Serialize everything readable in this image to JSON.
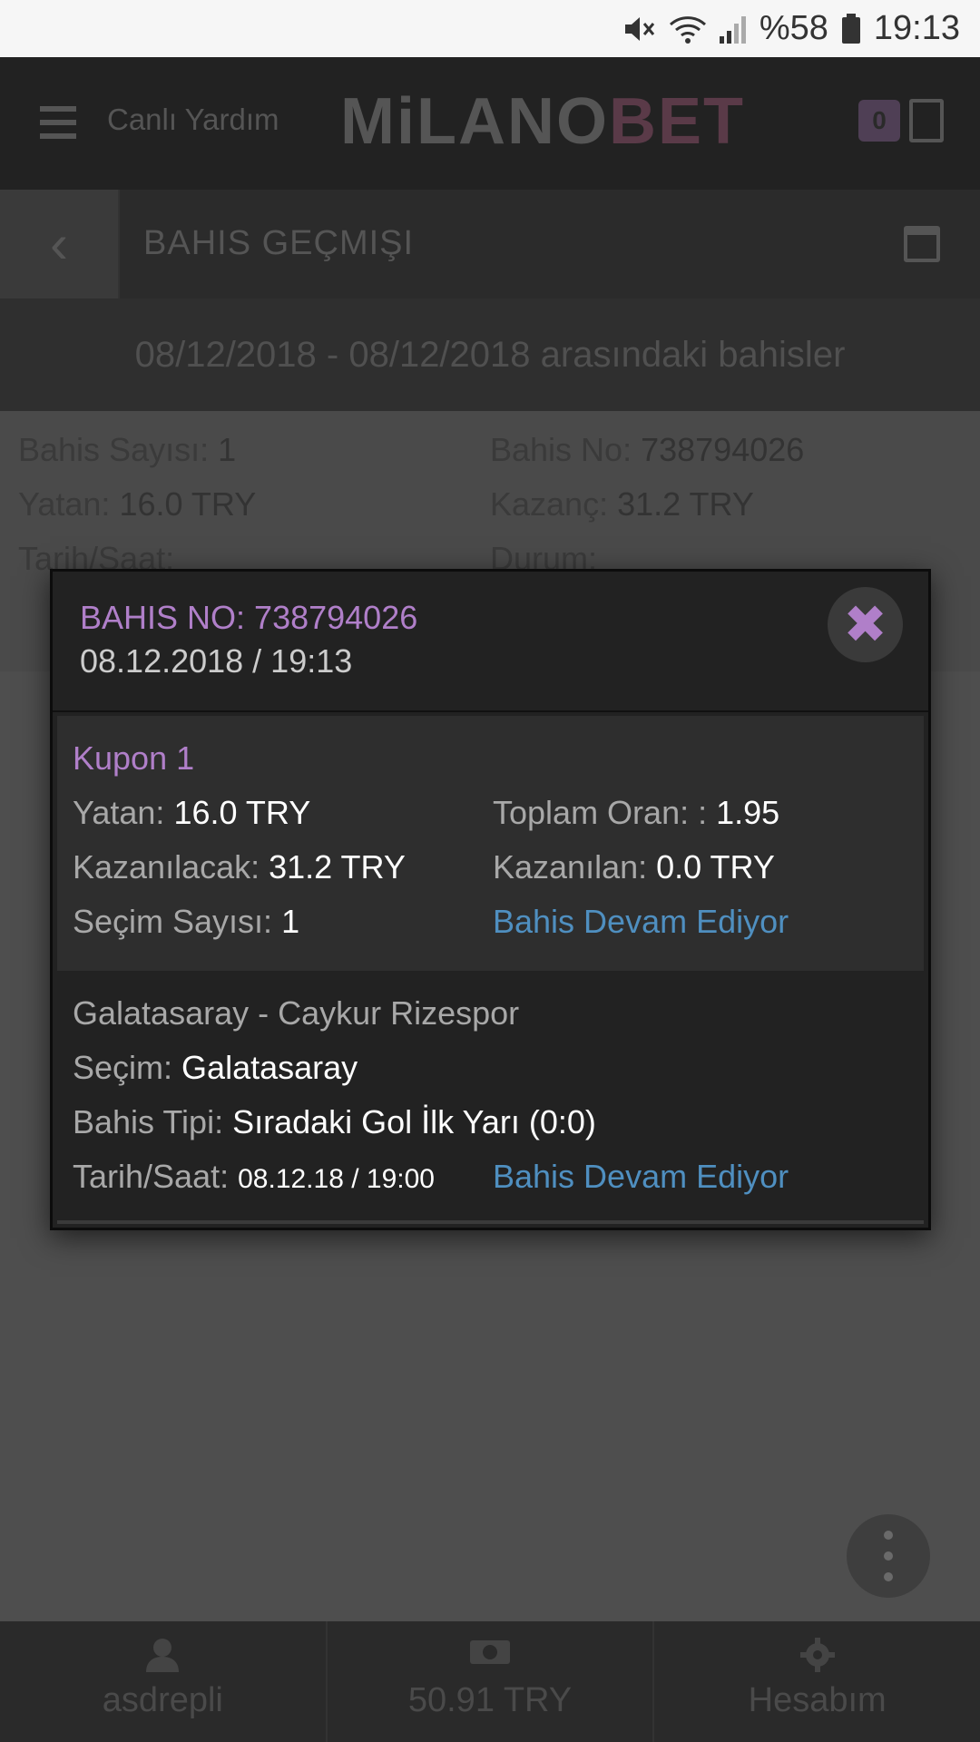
{
  "status_bar": {
    "battery_pct": "%58",
    "time": "19:13"
  },
  "header": {
    "live_help": "Canlı Yardım",
    "logo_main": "MiLANO",
    "logo_accent": "BET",
    "betslip_count": "0"
  },
  "subheader": {
    "title": "BAHIS GEÇMIŞI"
  },
  "range_text": "08/12/2018 - 08/12/2018 arasındaki bahisler",
  "summary": {
    "bet_count_label": "Bahis Sayısı:",
    "bet_count_value": "1",
    "bet_no_label": "Bahis No:",
    "bet_no_value": "738794026",
    "stake_label": "Yatan:",
    "stake_value": "16.0 TRY",
    "win_label": "Kazanç:",
    "win_value": "31.2 TRY",
    "date_label": "Tarih/Saat:",
    "status_label": "Durum:"
  },
  "modal": {
    "bet_no": "BAHIS NO: 738794026",
    "datetime": "08.12.2018 / 19:13",
    "close_symbol": "✖",
    "coupon": {
      "title": "Kupon 1",
      "stake_label": "Yatan:",
      "stake_value": "16.0 TRY",
      "total_odds_label": "Toplam Oran: :",
      "total_odds_value": "1.95",
      "to_win_label": "Kazanılacak:",
      "to_win_value": "31.2 TRY",
      "won_label": "Kazanılan:",
      "won_value": "0.0 TRY",
      "selections_label": "Seçim Sayısı:",
      "selections_value": "1",
      "status": "Bahis Devam Ediyor"
    },
    "selection": {
      "match": "Galatasaray - Caykur Rizespor",
      "pick_label": "Seçim:",
      "pick_value": "Galatasaray",
      "type_label": "Bahis Tipi:",
      "type_value": "Sıradaki Gol İlk Yarı (0:0)",
      "datetime_label": "Tarih/Saat:",
      "datetime_value": "08.12.18 / 19:00",
      "status": "Bahis Devam Ediyor"
    }
  },
  "bottom_bar": {
    "user": "asdrepli",
    "balance": "50.91 TRY",
    "account": "Hesabım"
  }
}
